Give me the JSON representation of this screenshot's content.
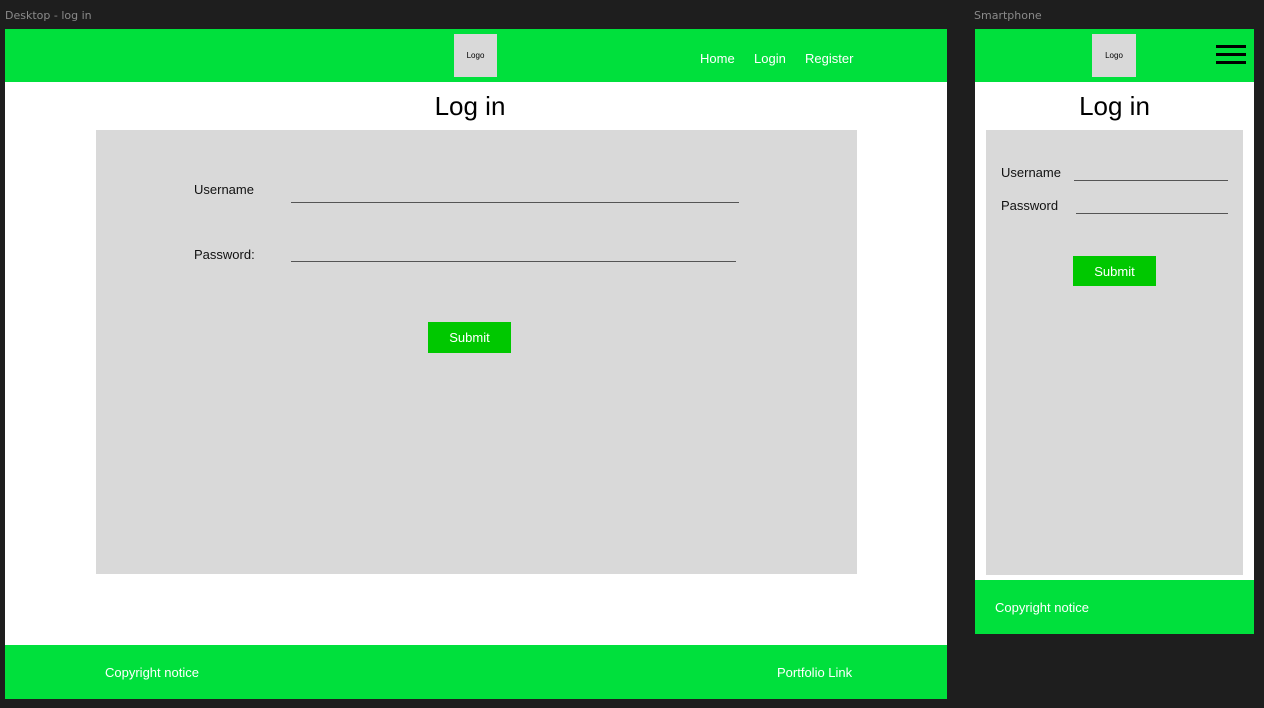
{
  "desktop": {
    "frame_label": "Desktop - log in",
    "logo": "Logo",
    "nav": [
      "Home",
      "Login",
      "Register"
    ],
    "title": "Log in",
    "username_label": "Username",
    "password_label": "Password:",
    "submit": "Submit",
    "footer_left": "Copyright notice",
    "footer_right": "Portfolio Link"
  },
  "mobile": {
    "frame_label": "Smartphone",
    "logo": "Logo",
    "menu_icon": "hamburger-icon",
    "title": "Log in",
    "username_label": "Username",
    "password_label": "Password",
    "submit": "Submit",
    "footer": "Copyright notice"
  },
  "colors": {
    "accent_green": "#00e03c",
    "button_green": "#00c800",
    "panel_gray": "#d9d9d9",
    "canvas_dark": "#1e1e1e"
  }
}
